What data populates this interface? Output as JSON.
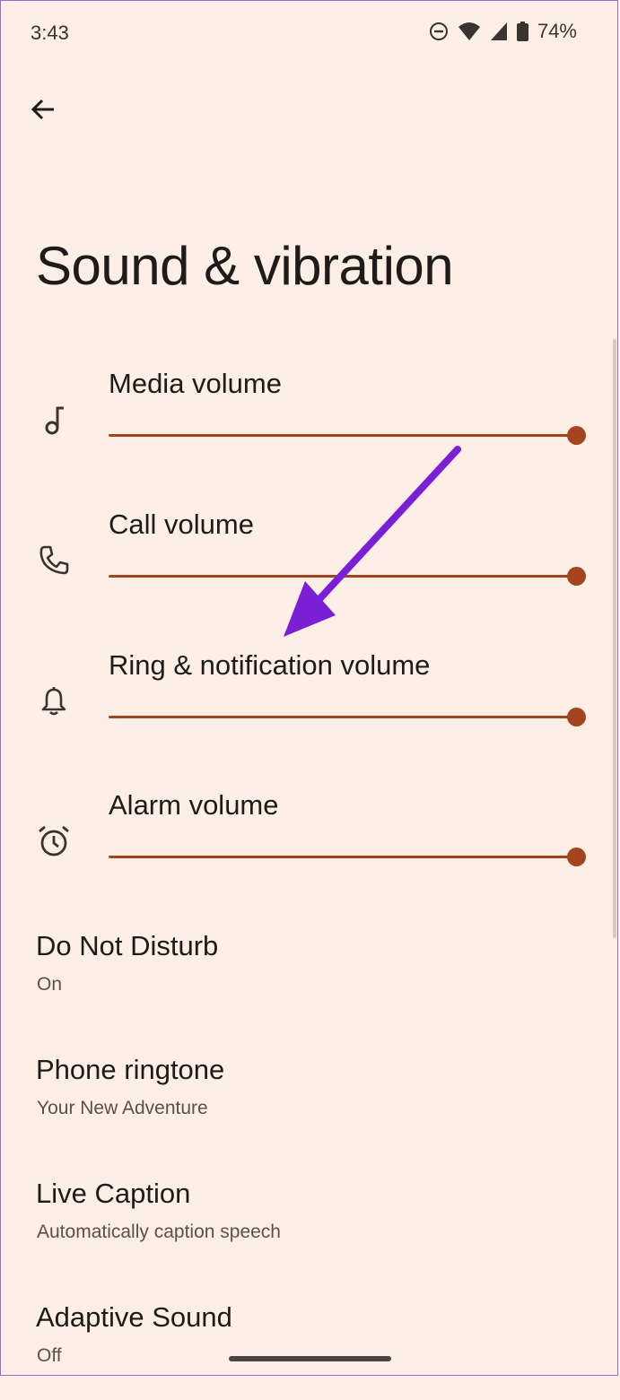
{
  "status_bar": {
    "time": "3:43",
    "battery": "74%",
    "icons": [
      "dnd-icon",
      "wifi-icon",
      "signal-icon",
      "battery-icon"
    ]
  },
  "header": {
    "back_icon": "arrow-back-icon",
    "title": "Sound & vibration"
  },
  "volumes": [
    {
      "label": "Media volume",
      "icon": "music-note-icon",
      "level": 1.0
    },
    {
      "label": "Call volume",
      "icon": "phone-icon",
      "level": 1.0
    },
    {
      "label": "Ring & notification volume",
      "icon": "bell-icon",
      "level": 1.0
    },
    {
      "label": "Alarm volume",
      "icon": "alarm-icon",
      "level": 1.0
    }
  ],
  "settings": [
    {
      "title": "Do Not Disturb",
      "summary": "On"
    },
    {
      "title": "Phone ringtone",
      "summary": "Your New Adventure"
    },
    {
      "title": "Live Caption",
      "summary": "Automatically caption speech"
    },
    {
      "title": "Adaptive Sound",
      "summary": "Off"
    }
  ],
  "colors": {
    "background": "#fdeee6",
    "accent": "#a5431f",
    "annotation": "#7a1fd6"
  }
}
